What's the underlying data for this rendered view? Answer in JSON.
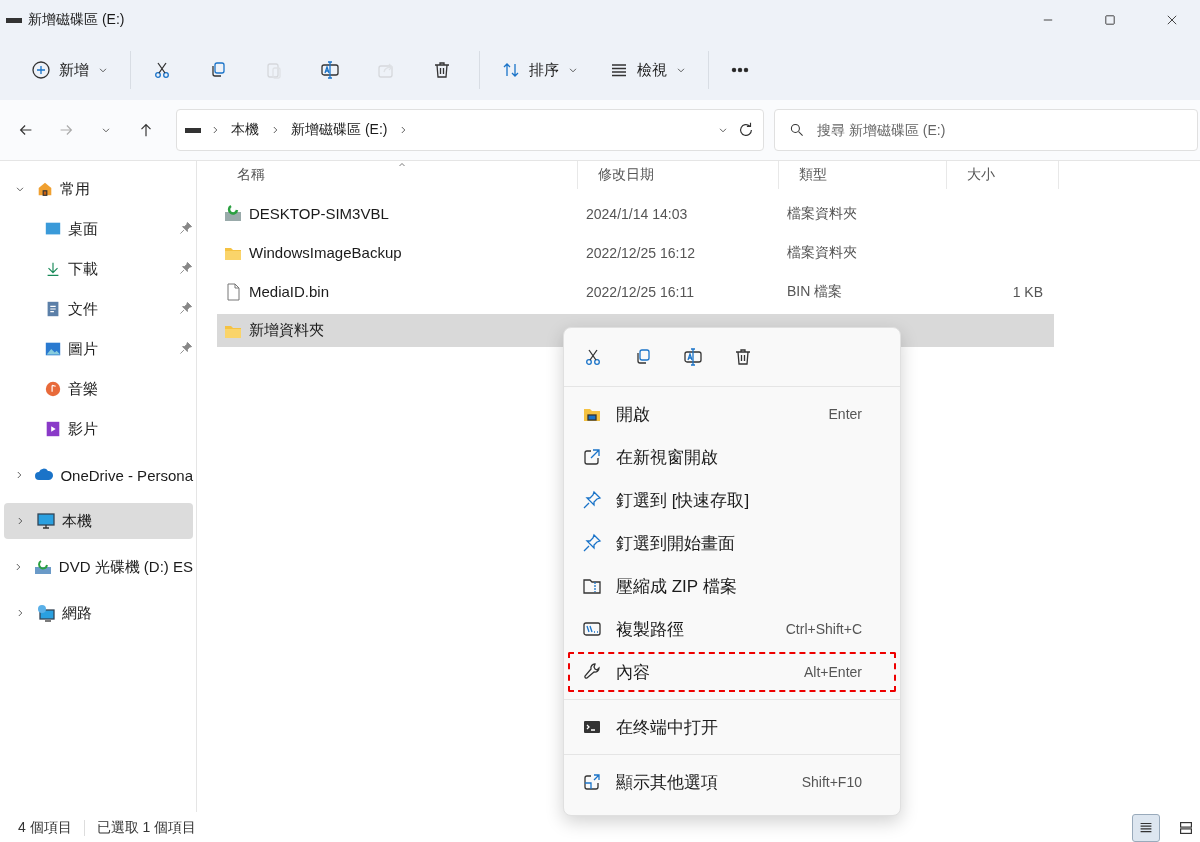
{
  "window": {
    "title": "新增磁碟區 (E:)"
  },
  "toolbar": {
    "new_label": "新增",
    "buttons": [
      {
        "disabled": false
      },
      {
        "disabled": false
      },
      {
        "disabled": true
      },
      {
        "disabled": false
      },
      {
        "disabled": true
      },
      {
        "disabled": false
      }
    ],
    "sort_label": "排序",
    "view_label": "檢視"
  },
  "nav": {
    "forward_disabled": true,
    "breadcrumb": [
      "本機",
      "新增磁碟區 (E:)"
    ],
    "search": {
      "placeholder": "搜尋 新增磁碟區 (E:)"
    }
  },
  "sidebar": {
    "items": [
      {
        "label": "常用",
        "expanded": true,
        "selected": false,
        "children": [
          {
            "label": "桌面",
            "pinned": true,
            "selected": false
          },
          {
            "label": "下載",
            "pinned": true,
            "selected": false
          },
          {
            "label": "文件",
            "pinned": true,
            "selected": false
          },
          {
            "label": "圖片",
            "pinned": true,
            "selected": false
          },
          {
            "label": "音樂",
            "pinned": false,
            "selected": false
          },
          {
            "label": "影片",
            "pinned": false,
            "selected": false
          }
        ]
      },
      {
        "label": "OneDrive - Persona",
        "expanded": false,
        "selected": false
      },
      {
        "label": "本機",
        "expanded": false,
        "selected": true
      },
      {
        "label": "DVD 光碟機 (D:) ES",
        "expanded": false,
        "selected": false
      },
      {
        "label": "網路",
        "expanded": false,
        "selected": false
      }
    ]
  },
  "table": {
    "columns": [
      "名稱",
      "修改日期",
      "類型",
      "大小"
    ],
    "rows": [
      {
        "name": "DESKTOP-SIM3VBL",
        "date": "2024/1/14 14:03",
        "type": "檔案資料夾",
        "kind": "backup",
        "selected": false
      },
      {
        "name": "WindowsImageBackup",
        "date": "2022/12/25 16:12",
        "type": "檔案資料夾",
        "kind": "folder",
        "selected": false
      },
      {
        "name": "MediaID.bin",
        "date": "2022/12/25 16:11",
        "type": "BIN 檔案",
        "size": "1 KB",
        "kind": "file",
        "selected": false
      },
      {
        "name": "新增資料夾",
        "kind": "folder",
        "selected": true
      }
    ]
  },
  "context_menu": {
    "groups": [
      [
        {
          "label": "開啟",
          "shortcut": "Enter",
          "highlighted": false
        },
        {
          "label": "在新視窗開啟",
          "highlighted": false
        },
        {
          "label": "釘選到 [快速存取]",
          "highlighted": false
        },
        {
          "label": "釘選到開始畫面",
          "highlighted": false
        },
        {
          "label": "壓縮成 ZIP 檔案",
          "highlighted": false
        },
        {
          "label": "複製路徑",
          "shortcut": "Ctrl+Shift+C",
          "highlighted": false
        },
        {
          "label": "內容",
          "shortcut": "Alt+Enter",
          "highlighted": true
        }
      ],
      [
        {
          "label": "在终端中打开",
          "highlighted": false
        }
      ],
      [
        {
          "label": "顯示其他選項",
          "shortcut": "Shift+F10",
          "highlighted": false
        }
      ]
    ]
  },
  "status_bar": {
    "count": "4 個項目",
    "selection": "已選取 1 個項目",
    "views": [
      {
        "selected": true
      },
      {
        "selected": false
      }
    ]
  }
}
